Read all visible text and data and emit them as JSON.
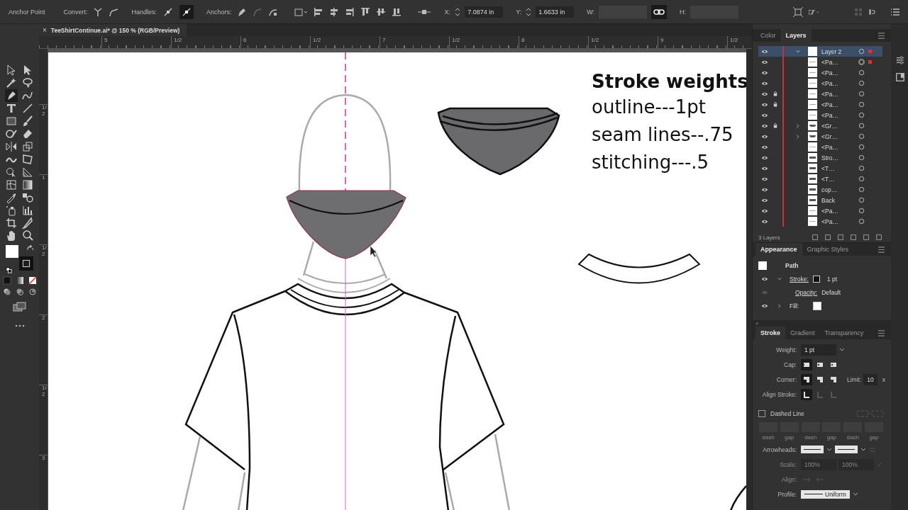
{
  "control_bar": {
    "mode": "Anchor Point",
    "convert_label": "Convert:",
    "handles_label": "Handles:",
    "handles": [
      {
        "selected": false
      },
      {
        "selected": true
      }
    ],
    "anchors_label": "Anchors:",
    "x_label": "X:",
    "x_value": "7.0874 in",
    "y_label": "Y:",
    "y_value": "1.6633 in",
    "w_label": "W:",
    "h_label": "H:"
  },
  "document_tab": {
    "close": "×",
    "title": "TeeShirtContinue.ai* @ 150 % (RGB/Preview)"
  },
  "horizontal_ruler": [
    "5",
    "1/2",
    "6",
    "1/2",
    "7",
    "1/2",
    "8",
    "1/2",
    "9",
    "1/2"
  ],
  "vertical_ruler": [
    "1/2",
    "1",
    "1/2",
    "2",
    "1/2",
    "3"
  ],
  "canvas": {
    "notes": [
      {
        "text": "Stroke weights",
        "kind": "heading"
      },
      {
        "text": "outline---1pt",
        "kind": "line"
      },
      {
        "text": "seam lines--.75",
        "kind": "line"
      },
      {
        "text": "stitching---.5",
        "kind": "line"
      }
    ]
  },
  "layers_panel": {
    "tabs": [
      {
        "label": "Color",
        "selected": false
      },
      {
        "label": "Layers",
        "selected": true
      }
    ],
    "layers": [
      {
        "name": "Layer 2",
        "expanded": true,
        "selected": true,
        "children": [
          {
            "name": "<Pa…",
            "kind": "path",
            "locked": false,
            "selected": true
          },
          {
            "name": "<Pa…",
            "kind": "path",
            "locked": false,
            "selected": false
          },
          {
            "name": "<Pa…",
            "kind": "path",
            "locked": false,
            "selected": false
          },
          {
            "name": "<Pa…",
            "kind": "path",
            "locked": true,
            "selected": false
          },
          {
            "name": "<Pa…",
            "kind": "path",
            "locked": true,
            "selected": false
          },
          {
            "name": "<Pa…",
            "kind": "path",
            "locked": false,
            "selected": false
          },
          {
            "name": "<Gr…",
            "kind": "group",
            "locked": true,
            "selected": false
          },
          {
            "name": "<Gr…",
            "kind": "group",
            "locked": false,
            "selected": false
          },
          {
            "name": "<Pa…",
            "kind": "path",
            "locked": false,
            "selected": false
          },
          {
            "name": "Stro…",
            "kind": "text",
            "locked": false,
            "selected": false
          },
          {
            "name": "<T…",
            "kind": "text",
            "locked": false,
            "selected": false
          },
          {
            "name": "<T…",
            "kind": "text",
            "locked": false,
            "selected": false
          },
          {
            "name": "cop…",
            "kind": "text",
            "locked": false,
            "selected": false
          },
          {
            "name": "Back",
            "kind": "text",
            "locked": false,
            "selected": false
          },
          {
            "name": "<Pa…",
            "kind": "path",
            "locked": false,
            "selected": false
          },
          {
            "name": "<Pa…",
            "kind": "path",
            "locked": false,
            "selected": false
          }
        ]
      }
    ],
    "footer": "3 Layers"
  },
  "appearance_panel": {
    "tabs": [
      {
        "label": "Appearance",
        "selected": true
      },
      {
        "label": "Graphic Styles",
        "selected": false
      }
    ],
    "object": "Path",
    "stroke_label": "Stroke:",
    "stroke_value": "1 pt",
    "opacity_label": "Opacity:",
    "opacity_value": "Default",
    "fill_label": "Fill:"
  },
  "stroke_panel": {
    "close": "×",
    "tabs": [
      {
        "label": "Stroke",
        "selected": true
      },
      {
        "label": "Gradient",
        "selected": false
      },
      {
        "label": "Transparency",
        "selected": false
      }
    ],
    "weight_label": "Weight:",
    "weight_value": "1 pt",
    "cap_label": "Cap:",
    "corner_label": "Corner:",
    "limit_label": "Limit:",
    "limit_value": "10",
    "limit_unit": "x",
    "align_label": "Align Stroke:",
    "dashed_line": {
      "label": "Dashed Line",
      "checked": false
    },
    "dash_fields": [
      "dash",
      "gap",
      "dash",
      "gap",
      "dash",
      "gap"
    ],
    "arrowheads_label": "Arrowheads:",
    "scale_label": "Scale:",
    "scale_values": [
      "100%",
      "100%"
    ],
    "arrow_align_label": "Align:",
    "profile_label": "Profile:",
    "profile_value": "Uniform"
  }
}
